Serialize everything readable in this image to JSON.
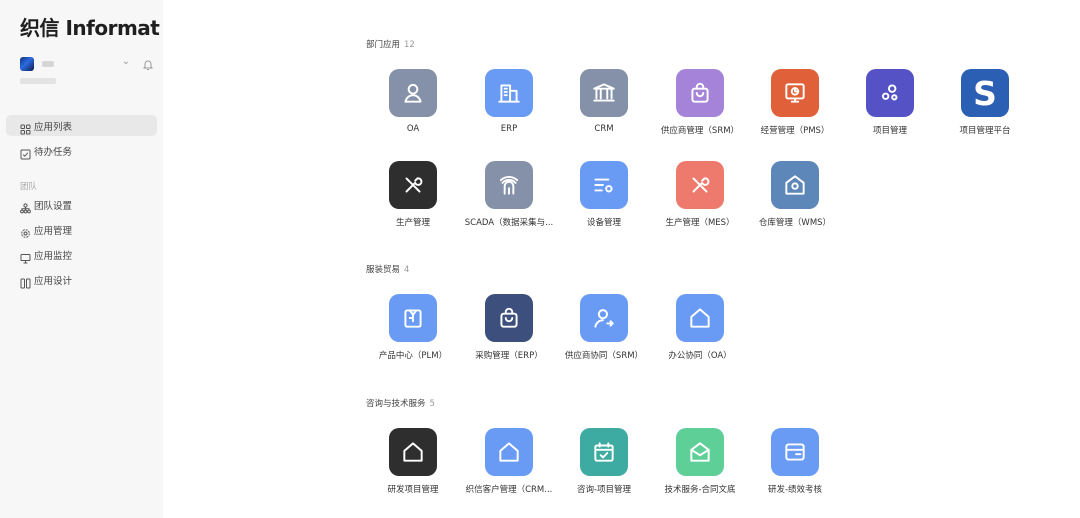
{
  "sidebar": {
    "logo": "织信 Informat",
    "nav": [
      {
        "label": "应用列表",
        "icon": "grid-icon",
        "active": true
      },
      {
        "label": "待办任务",
        "icon": "checkbox-icon",
        "active": false
      }
    ],
    "group_label": "团队",
    "group_items": [
      {
        "label": "团队设置",
        "icon": "org-icon"
      },
      {
        "label": "应用管理",
        "icon": "gear-icon"
      },
      {
        "label": "应用监控",
        "icon": "monitor-icon"
      },
      {
        "label": "应用设计",
        "icon": "design-icon"
      }
    ]
  },
  "sections": [
    {
      "title": "部门应用",
      "count": "12",
      "apps": [
        {
          "label": "OA",
          "icon": "user-icon",
          "color": "#8591a8"
        },
        {
          "label": "ERP",
          "icon": "building-icon",
          "color": "#6a9bf4"
        },
        {
          "label": "CRM",
          "icon": "bank-icon",
          "color": "#8591a8"
        },
        {
          "label": "供应商管理（SRM）",
          "icon": "bag-icon",
          "color": "#a483d8"
        },
        {
          "label": "经营管理（PMS）",
          "icon": "presentation-icon",
          "color": "#e0603a"
        },
        {
          "label": "项目管理",
          "icon": "nodes-icon",
          "color": "#5552c5"
        },
        {
          "label": "项目管理平台",
          "icon": "s-logo-icon",
          "color": "#2a5fb3"
        },
        {
          "label": "生产管理",
          "icon": "tools-icon",
          "color": "#2e2e2e"
        },
        {
          "label": "SCADA（数据采集与...",
          "icon": "antenna-icon",
          "color": "#8591a8"
        },
        {
          "label": "设备管理",
          "icon": "list-gear-icon",
          "color": "#6a9bf4"
        },
        {
          "label": "生产管理（MES）",
          "icon": "tools-icon",
          "color": "#ee7a6e"
        },
        {
          "label": "仓库管理（WMS）",
          "icon": "warehouse-icon",
          "color": "#5d87b8"
        }
      ]
    },
    {
      "title": "服装贸易",
      "count": "4",
      "apps": [
        {
          "label": "产品中心（PLM）",
          "icon": "shirt-icon",
          "color": "#6a9bf4"
        },
        {
          "label": "采购管理（ERP）",
          "icon": "bag-icon",
          "color": "#3d4f7c"
        },
        {
          "label": "供应商协同（SRM）",
          "icon": "user-arrow-icon",
          "color": "#6a9bf4"
        },
        {
          "label": "办公协同（OA）",
          "icon": "home-icon",
          "color": "#6a9bf4"
        }
      ]
    },
    {
      "title": "咨询与技术服务",
      "count": "5",
      "apps": [
        {
          "label": "研发项目管理",
          "icon": "home-icon",
          "color": "#2e2e2e"
        },
        {
          "label": "织信客户管理（CRM...",
          "icon": "home-icon",
          "color": "#6a9bf4"
        },
        {
          "label": "咨询-项目管理",
          "icon": "calendar-check-icon",
          "color": "#3eaba2"
        },
        {
          "label": "技术服务-合同文底",
          "icon": "mail-icon",
          "color": "#5fcf98"
        },
        {
          "label": "研发-绩效考核",
          "icon": "card-icon",
          "color": "#6a9bf4"
        }
      ]
    }
  ]
}
